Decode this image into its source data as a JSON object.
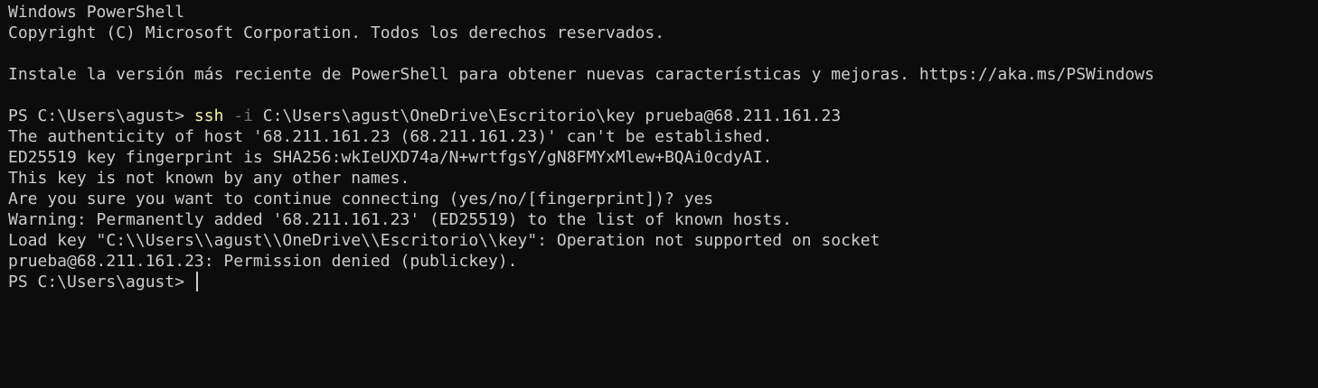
{
  "terminal": {
    "header_line_1": "Windows PowerShell",
    "header_line_2": "Copyright (C) Microsoft Corporation. Todos los derechos reservados.",
    "upgrade_notice": "Instale la versión más reciente de PowerShell para obtener nuevas características y mejoras. https://aka.ms/PSWindows",
    "prompt": "PS C:\\Users\\agust> ",
    "command": {
      "name": "ssh",
      "param": "-i",
      "args": "C:\\Users\\agust\\OneDrive\\Escritorio\\key prueba@68.211.161.23"
    },
    "output": [
      "The authenticity of host '68.211.161.23 (68.211.161.23)' can't be established.",
      "ED25519 key fingerprint is SHA256:wkIeUXD74a/N+wrtfgsY/gN8FMYxMlew+BQAi0cdyAI.",
      "This key is not known by any other names.",
      "Are you sure you want to continue connecting (yes/no/[fingerprint])? yes",
      "Warning: Permanently added '68.211.161.23' (ED25519) to the list of known hosts.",
      "Load key \"C:\\\\Users\\\\agust\\\\OneDrive\\\\Escritorio\\\\key\": Operation not supported on socket",
      "prueba@68.211.161.23: Permission denied (publickey)."
    ],
    "final_prompt": "PS C:\\Users\\agust> ",
    "colors": {
      "background": "#0c0c0c",
      "foreground": "#cccccc",
      "command": "#f9f1a5",
      "parameter": "#767676"
    }
  }
}
